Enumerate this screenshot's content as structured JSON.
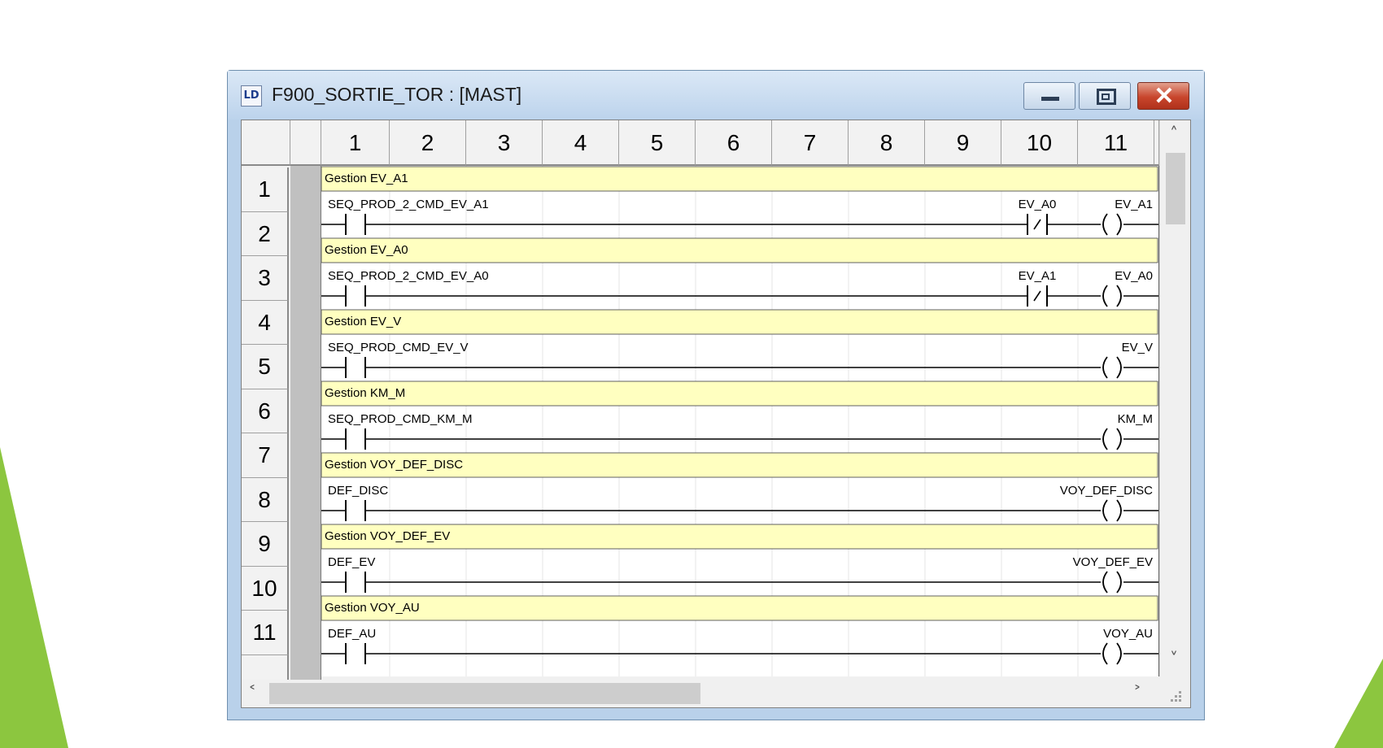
{
  "window": {
    "icon_label": "LD",
    "title": "F900_SORTIE_TOR : [MAST]"
  },
  "grid": {
    "column_headers": [
      "1",
      "2",
      "3",
      "4",
      "5",
      "6",
      "7",
      "8",
      "9",
      "10",
      "11"
    ],
    "row_headers": [
      "1",
      "2",
      "3",
      "4",
      "5",
      "6",
      "7",
      "8",
      "9",
      "10",
      "11"
    ]
  },
  "rungs": [
    {
      "comment": "Gestion EV_A1",
      "contact": "SEQ_PROD_2_CMD_EV_A1",
      "nc_contact": "EV_A0",
      "coil": "EV_A1"
    },
    {
      "comment": "Gestion EV_A0",
      "contact": "SEQ_PROD_2_CMD_EV_A0",
      "nc_contact": "EV_A1",
      "coil": "EV_A0"
    },
    {
      "comment": "Gestion EV_V",
      "contact": "SEQ_PROD_CMD_EV_V",
      "nc_contact": null,
      "coil": "EV_V"
    },
    {
      "comment": "Gestion KM_M",
      "contact": "SEQ_PROD_CMD_KM_M",
      "nc_contact": null,
      "coil": "KM_M"
    },
    {
      "comment": "Gestion VOY_DEF_DISC",
      "contact": "DEF_DISC",
      "nc_contact": null,
      "coil": "VOY_DEF_DISC"
    },
    {
      "comment": "Gestion VOY_DEF_EV",
      "contact": "DEF_EV",
      "nc_contact": null,
      "coil": "VOY_DEF_EV"
    },
    {
      "comment": "Gestion VOY_AU",
      "contact": "DEF_AU",
      "nc_contact": null,
      "coil": "VOY_AU"
    }
  ],
  "colors": {
    "comment_fill": "#ffffc0",
    "accent_green": "#8cc63f"
  }
}
